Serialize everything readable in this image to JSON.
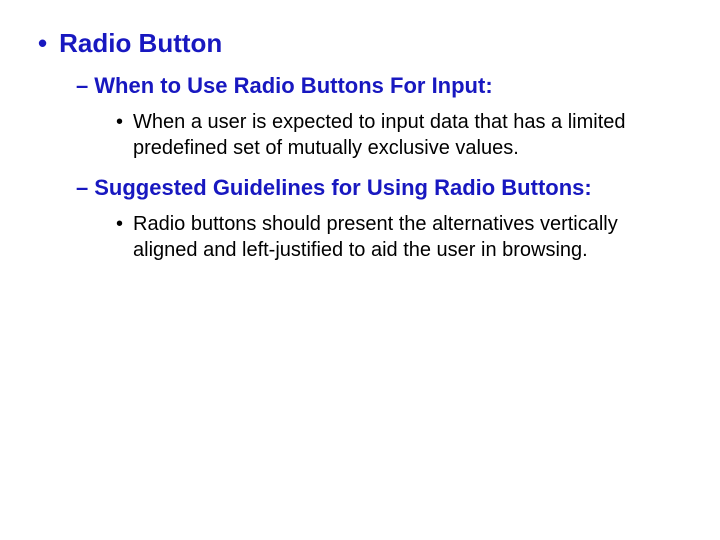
{
  "slide": {
    "heading": "Radio Button",
    "sections": [
      {
        "title": "When to Use Radio Buttons For Input:",
        "items": [
          "When a user is expected to input data that has a limited predefined set of mutually exclusive values."
        ]
      },
      {
        "title": "Suggested Guidelines for Using Radio Buttons:",
        "items": [
          "Radio buttons should present the alternatives vertically aligned and left-justified to aid the user in browsing."
        ]
      }
    ]
  }
}
